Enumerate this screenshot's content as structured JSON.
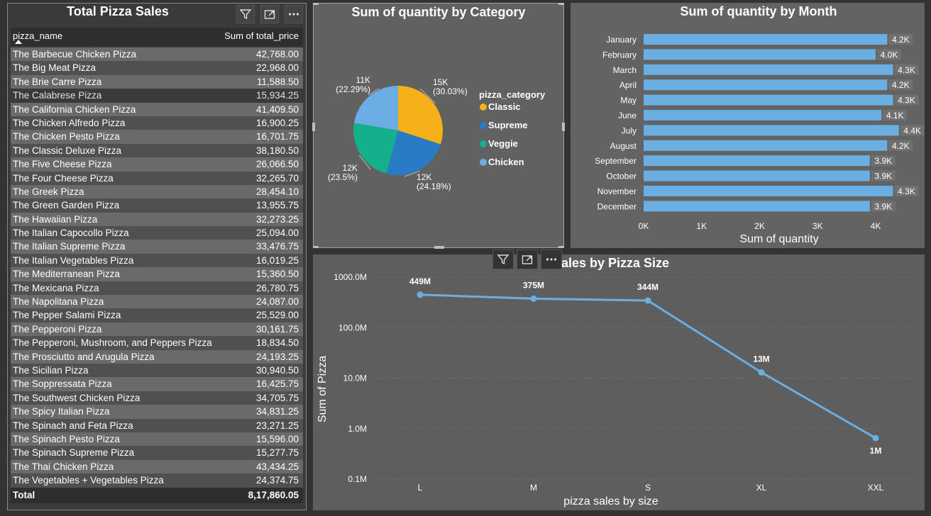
{
  "table": {
    "title": "Total Pizza Sales",
    "col_name": "pizza_name",
    "col_value": "Sum of total_price",
    "rows": [
      {
        "name": "The Barbecue Chicken Pizza",
        "value": "42,768.00"
      },
      {
        "name": "The Big Meat Pizza",
        "value": "22,968.00"
      },
      {
        "name": "The Brie Carre Pizza",
        "value": "11,588.50"
      },
      {
        "name": "The Calabrese Pizza",
        "value": "15,934.25"
      },
      {
        "name": "The California Chicken Pizza",
        "value": "41,409.50"
      },
      {
        "name": "The Chicken Alfredo Pizza",
        "value": "16,900.25"
      },
      {
        "name": "The Chicken Pesto Pizza",
        "value": "16,701.75"
      },
      {
        "name": "The Classic Deluxe Pizza",
        "value": "38,180.50"
      },
      {
        "name": "The Five Cheese Pizza",
        "value": "26,066.50"
      },
      {
        "name": "The Four Cheese Pizza",
        "value": "32,265.70"
      },
      {
        "name": "The Greek Pizza",
        "value": "28,454.10"
      },
      {
        "name": "The Green Garden Pizza",
        "value": "13,955.75"
      },
      {
        "name": "The Hawaiian Pizza",
        "value": "32,273.25"
      },
      {
        "name": "The Italian Capocollo Pizza",
        "value": "25,094.00"
      },
      {
        "name": "The Italian Supreme Pizza",
        "value": "33,476.75"
      },
      {
        "name": "The Italian Vegetables Pizza",
        "value": "16,019.25"
      },
      {
        "name": "The Mediterranean Pizza",
        "value": "15,360.50"
      },
      {
        "name": "The Mexicana Pizza",
        "value": "26,780.75"
      },
      {
        "name": "The Napolitana Pizza",
        "value": "24,087.00"
      },
      {
        "name": "The Pepper Salami Pizza",
        "value": "25,529.00"
      },
      {
        "name": "The Pepperoni Pizza",
        "value": "30,161.75"
      },
      {
        "name": "The Pepperoni, Mushroom, and Peppers Pizza",
        "value": "18,834.50"
      },
      {
        "name": "The Prosciutto and Arugula Pizza",
        "value": "24,193.25"
      },
      {
        "name": "The Sicilian Pizza",
        "value": "30,940.50"
      },
      {
        "name": "The Soppressata Pizza",
        "value": "16,425.75"
      },
      {
        "name": "The Southwest Chicken Pizza",
        "value": "34,705.75"
      },
      {
        "name": "The Spicy Italian Pizza",
        "value": "34,831.25"
      },
      {
        "name": "The Spinach and Feta Pizza",
        "value": "23,271.25"
      },
      {
        "name": "The Spinach Pesto Pizza",
        "value": "15,596.00"
      },
      {
        "name": "The Spinach Supreme Pizza",
        "value": "15,277.75"
      },
      {
        "name": "The Thai Chicken Pizza",
        "value": "43,434.25"
      },
      {
        "name": "The Vegetables + Vegetables Pizza",
        "value": "24,374.75"
      }
    ],
    "total_label": "Total",
    "total_value": "8,17,860.05"
  },
  "toolbar": {
    "filter_icon": "filter-icon",
    "focus_icon": "focus-mode-icon",
    "more_icon": "more-options-icon"
  },
  "colors": {
    "classic": "#f6b11a",
    "supreme": "#2a7bc6",
    "veggie": "#14b08c",
    "chicken": "#6baee6",
    "bar": "#6aaee2",
    "line": "#6aaee2"
  },
  "chart_data": [
    {
      "type": "pie",
      "title": "Sum of quantity by Category",
      "legend_title": "pizza_category",
      "legend_position": "right",
      "categories": [
        "Classic",
        "Supreme",
        "Veggie",
        "Chicken"
      ],
      "values": [
        15000,
        12000,
        12000,
        11000
      ],
      "labels": [
        [
          "15K",
          "(30.03%)"
        ],
        [
          "12K",
          "(24.18%)"
        ],
        [
          "12K",
          "(23.5%)"
        ],
        [
          "11K",
          "(22.29%)"
        ]
      ],
      "percent": [
        30.03,
        24.18,
        23.5,
        22.29
      ]
    },
    {
      "type": "bar",
      "orientation": "horizontal",
      "title": "Sum of quantity by Month",
      "categories": [
        "January",
        "February",
        "March",
        "April",
        "May",
        "June",
        "July",
        "August",
        "September",
        "October",
        "November",
        "December"
      ],
      "values": [
        4200,
        4000,
        4300,
        4200,
        4300,
        4100,
        4400,
        4200,
        3900,
        3900,
        4300,
        3900
      ],
      "data_labels": [
        "4.2K",
        "4.0K",
        "4.3K",
        "4.2K",
        "4.3K",
        "4.1K",
        "4.4K",
        "4.2K",
        "3.9K",
        "3.9K",
        "4.3K",
        "3.9K"
      ],
      "xlabel": "Sum of quantity",
      "xticks": [
        "0K",
        "1K",
        "2K",
        "3K",
        "4K"
      ],
      "xlim": [
        0,
        4600
      ],
      "grid": false
    },
    {
      "type": "line",
      "title": "Sales by Pizza Size",
      "title_visible": "Sales by Pizza Size",
      "categories": [
        "L",
        "M",
        "S",
        "XL",
        "XXL"
      ],
      "values": [
        449000000,
        375000000,
        344000000,
        13000000,
        650000
      ],
      "data_labels": [
        "449M",
        "375M",
        "344M",
        "13M",
        "1M"
      ],
      "xlabel": "pizza sales by size",
      "ylabel": "Sum of Pizza",
      "yscale": "log",
      "yticks": [
        "1000.0M",
        "100.0M",
        "10.0M",
        "1.0M",
        "0.1M"
      ],
      "ylim": [
        100000,
        1000000000
      ],
      "grid": true
    }
  ]
}
